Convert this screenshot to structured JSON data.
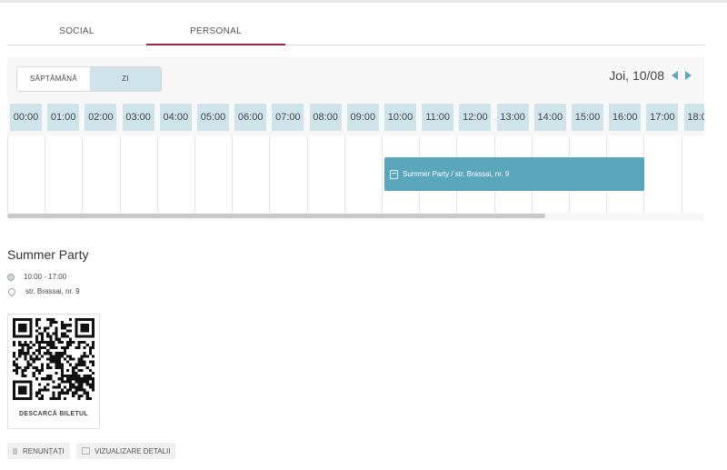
{
  "tabs": [
    {
      "label": "SOCIAL"
    },
    {
      "label": "PERSONAL"
    }
  ],
  "calendar": {
    "view_week": "SĂPTĂMÂNĂ",
    "view_day": "ZI",
    "active_view": "ZI",
    "date": "Joi, 10/08",
    "hours": [
      "00:00",
      "01:00",
      "02:00",
      "03:00",
      "04:00",
      "05:00",
      "06:00",
      "07:00",
      "08:00",
      "09:00",
      "10:00",
      "11:00",
      "12:00",
      "13:00",
      "14:00",
      "15:00",
      "16:00",
      "17:00",
      "18:00"
    ],
    "event_label": "Summer Party / str. Brassai, nr. 9",
    "accent_color": "#a0244e",
    "event_color": "#5aa6bd",
    "hour_chip_color": "#cfe3ea"
  },
  "event": {
    "title": "Summer Party",
    "time": "10:00 - 17:00",
    "location": "str. Brassai, nr. 9"
  },
  "ticket": {
    "download_label": "DESCARCĂ BILETUL"
  },
  "actions": {
    "cancel_label": "RENUNȚAȚI",
    "details_label": "VIZUALIZARE DETALII"
  }
}
